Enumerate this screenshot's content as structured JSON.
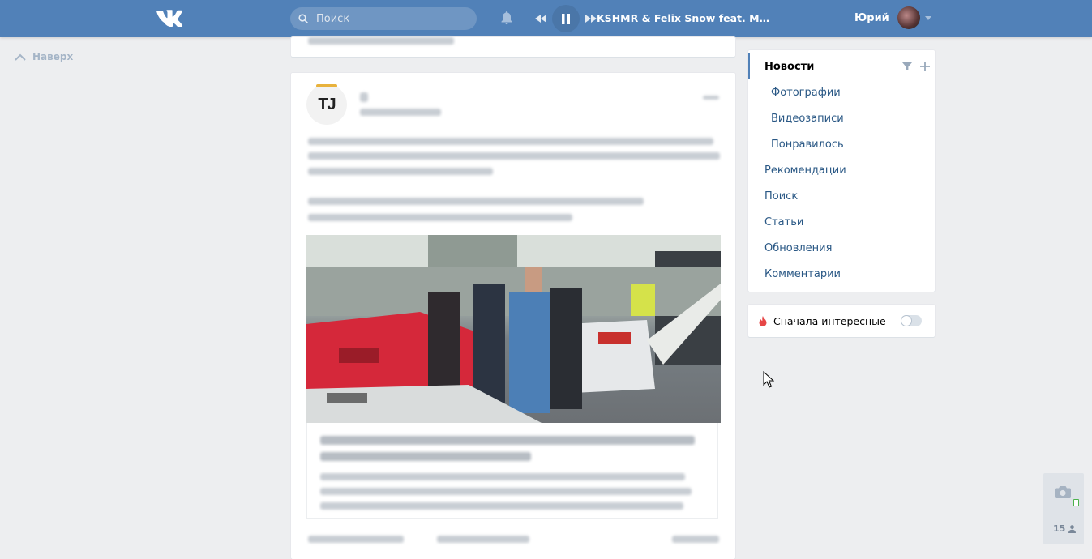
{
  "header": {
    "search_placeholder": "Поиск",
    "now_playing": "KSHMR & Felix Snow feat. Madi – To...",
    "user_name": "Юрий"
  },
  "left": {
    "up_label": "Наверх"
  },
  "post": {
    "author_avatar_text": "TJ"
  },
  "sidebar": {
    "items": [
      {
        "label": "Новости",
        "active": true
      },
      {
        "label": "Фотографии",
        "sub": true
      },
      {
        "label": "Видеозаписи",
        "sub": true
      },
      {
        "label": "Понравилось",
        "sub": true
      },
      {
        "label": "Рекомендации"
      },
      {
        "label": "Поиск"
      },
      {
        "label": "Статьи"
      },
      {
        "label": "Обновления"
      },
      {
        "label": "Комментарии"
      }
    ],
    "interesting_first_label": "Сначала интересные"
  },
  "widget": {
    "online_count": "15"
  },
  "colors": {
    "header": "#5181b8",
    "link": "#2a5885",
    "background": "#edeef0"
  }
}
